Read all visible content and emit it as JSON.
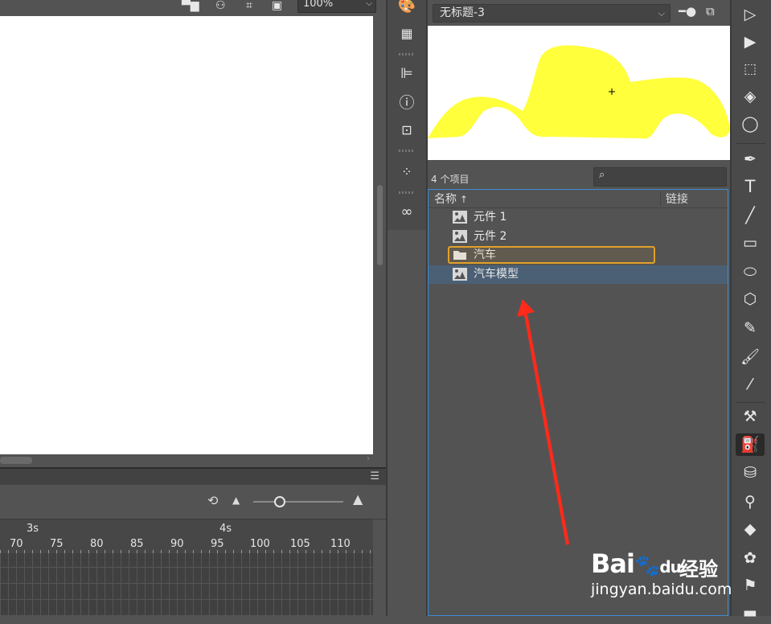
{
  "stage": {
    "zoom": "100%"
  },
  "timeline": {
    "seconds": [
      "3s",
      "4s"
    ],
    "frames": [
      "70",
      "75",
      "80",
      "85",
      "90",
      "95",
      "100",
      "105",
      "110"
    ]
  },
  "library": {
    "document": "无标题-3",
    "item_count": "4 个项目",
    "search_placeholder": "",
    "col_name": "名称",
    "col_linkage": "链接",
    "items": [
      {
        "label": "元件 1",
        "icon": "graphic-symbol-icon"
      },
      {
        "label": "元件 2",
        "icon": "graphic-symbol-icon"
      },
      {
        "label": "汽车",
        "icon": "folder-icon"
      },
      {
        "label": "汽车模型",
        "icon": "graphic-symbol-icon"
      }
    ],
    "preview_fill": "#ffff3c"
  },
  "annotation": {
    "arrow_color": "#ff2a1a",
    "highlight_color": "#e0a12a"
  },
  "watermark": {
    "brand": "Bai",
    "brand2": "du",
    "brand_cn": "经验",
    "url": "jingyan.baidu.com"
  }
}
